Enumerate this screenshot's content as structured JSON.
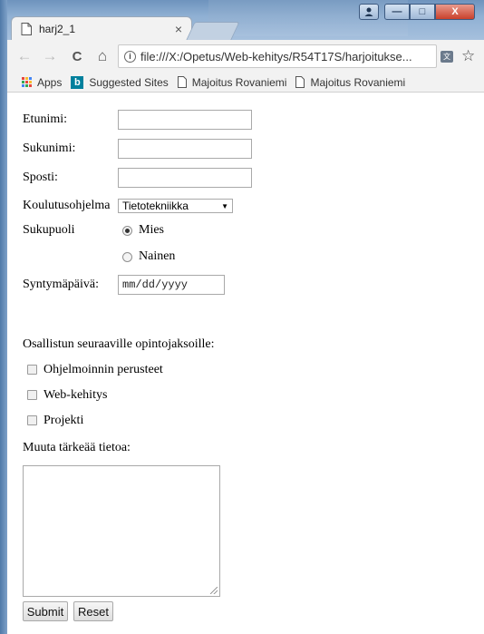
{
  "browser": {
    "tab_title": "harj2_1",
    "tab_close": "×",
    "url": "file:///X:/Opetus/Web-kehitys/R54T17S/harjoitukse...",
    "back_icon": "←",
    "forward_icon": "→",
    "reload_icon": "C",
    "home_icon": "⌂",
    "info_icon": "i",
    "translate_icon": "文",
    "star_icon": "☆",
    "menu_icon": "⋮",
    "window_buttons": {
      "minimize": "—",
      "maximize": "□",
      "close": "X"
    },
    "bookmarks": [
      {
        "label": "Apps",
        "icon": "apps-grid-icon"
      },
      {
        "label": "Suggested Sites",
        "icon": "bing-icon"
      },
      {
        "label": "Majoitus Rovaniemi",
        "icon": "page-icon"
      },
      {
        "label": "Majoitus Rovaniemi",
        "icon": "page-icon"
      }
    ]
  },
  "form": {
    "first_name_label": "Etunimi:",
    "first_name_value": "",
    "last_name_label": "Sukunimi:",
    "last_name_value": "",
    "email_label": "Sposti:",
    "email_value": "",
    "program_label": "Koulutusohjelma",
    "program_selected": "Tietotekniikka",
    "gender_label": "Sukupuoli",
    "gender_options": [
      {
        "label": "Mies",
        "checked": true
      },
      {
        "label": "Nainen",
        "checked": false
      }
    ],
    "birthday_label": "Syntymäpäivä:",
    "birthday_placeholder": "mm/dd/yyyy",
    "courses_heading": "Osallistun seuraaville opintojaksoille:",
    "courses": [
      {
        "label": "Ohjelmoinnin perusteet",
        "checked": false
      },
      {
        "label": "Web-kehitys",
        "checked": false
      },
      {
        "label": "Projekti",
        "checked": false
      }
    ],
    "other_info_label": "Muuta tärkeää tietoa:",
    "other_info_value": "",
    "submit_label": "Submit",
    "reset_label": "Reset"
  },
  "colors": {
    "apps_grid": [
      "#e8453c",
      "#f9bb2d",
      "#4285f4",
      "#34a853",
      "#e8453c",
      "#f9bb2d",
      "#4285f4",
      "#34a853",
      "#e8453c"
    ],
    "bing": "#00809d"
  }
}
